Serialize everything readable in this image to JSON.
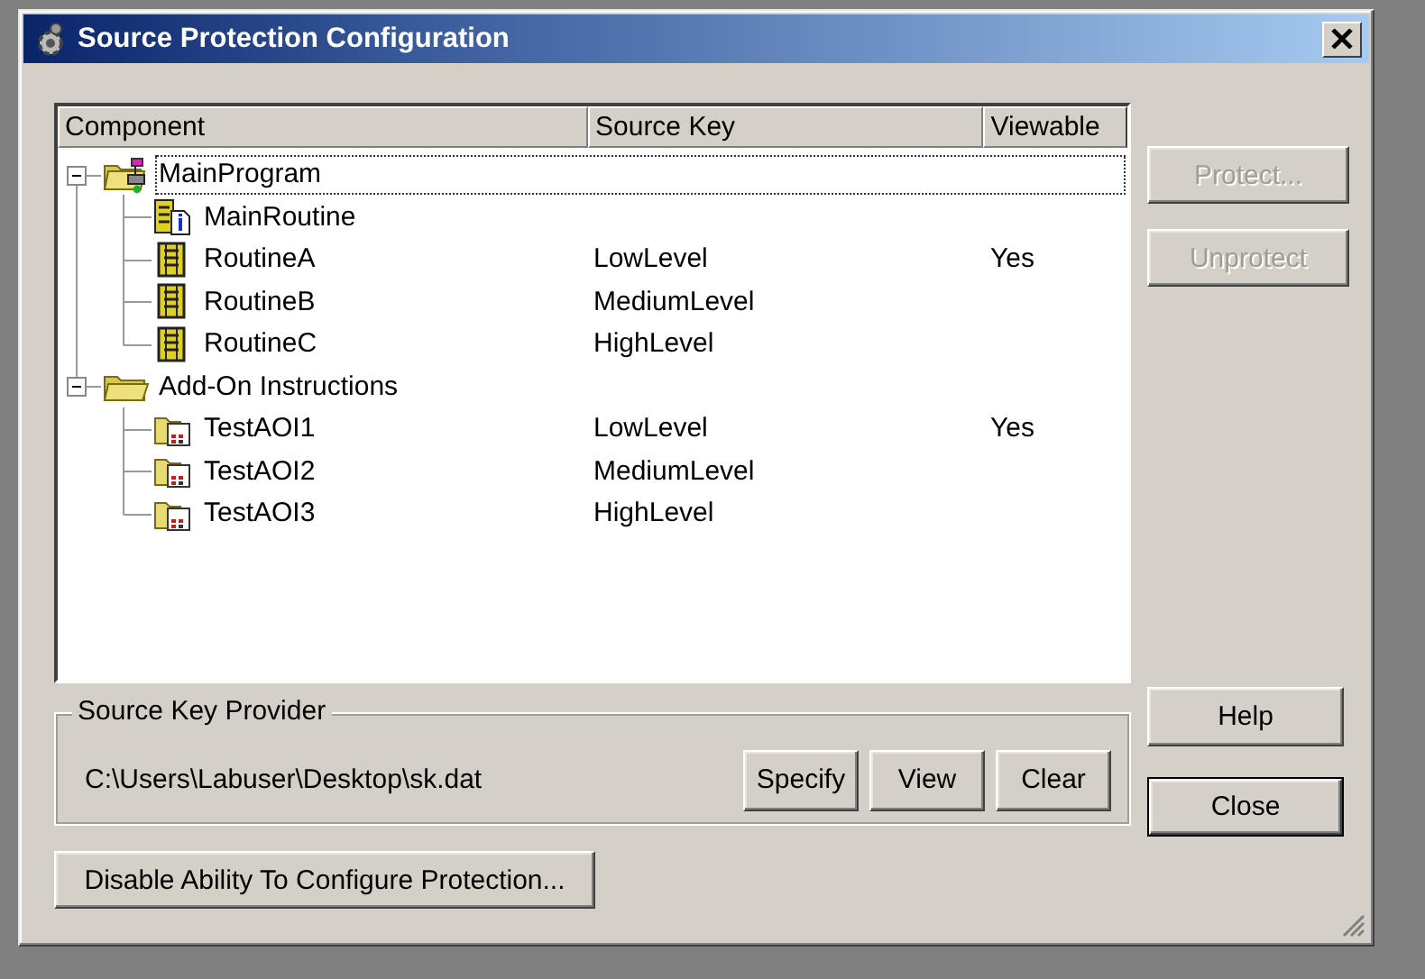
{
  "window": {
    "title": "Source Protection Configuration"
  },
  "columns": [
    "Component",
    "Source Key",
    "Viewable"
  ],
  "tree": [
    {
      "name": "MainProgram",
      "kind": "program",
      "expanded": true,
      "selected": true,
      "children": [
        {
          "name": "MainRoutine",
          "kind": "main-routine",
          "selected": false
        },
        {
          "name": "RoutineA",
          "kind": "routine",
          "source_key": "LowLevel",
          "viewable": "Yes",
          "selected": false
        },
        {
          "name": "RoutineB",
          "kind": "routine",
          "source_key": "MediumLevel",
          "selected": false
        },
        {
          "name": "RoutineC",
          "kind": "routine",
          "source_key": "HighLevel",
          "selected": false
        }
      ]
    },
    {
      "name": "Add-On Instructions",
      "kind": "folder",
      "expanded": true,
      "selected": false,
      "children": [
        {
          "name": "TestAOI1",
          "kind": "aoi",
          "source_key": "LowLevel",
          "viewable": "Yes",
          "selected": false
        },
        {
          "name": "TestAOI2",
          "kind": "aoi",
          "source_key": "MediumLevel",
          "selected": false
        },
        {
          "name": "TestAOI3",
          "kind": "aoi",
          "source_key": "HighLevel",
          "selected": false
        }
      ]
    }
  ],
  "side_buttons": [
    {
      "label": "Protect...",
      "disabled": true
    },
    {
      "label": "Unprotect",
      "disabled": true
    }
  ],
  "source_key_provider": {
    "title": "Source Key Provider",
    "path": "C:\\Users\\Labuser\\Desktop\\sk.dat",
    "buttons": [
      {
        "label": "Specify"
      },
      {
        "label": "View"
      },
      {
        "label": "Clear"
      }
    ]
  },
  "dialog_buttons": [
    {
      "label": "Help",
      "default": false
    },
    {
      "label": "Close",
      "default": true
    }
  ],
  "disable_button": {
    "label": "Disable Ability To Configure Protection..."
  }
}
